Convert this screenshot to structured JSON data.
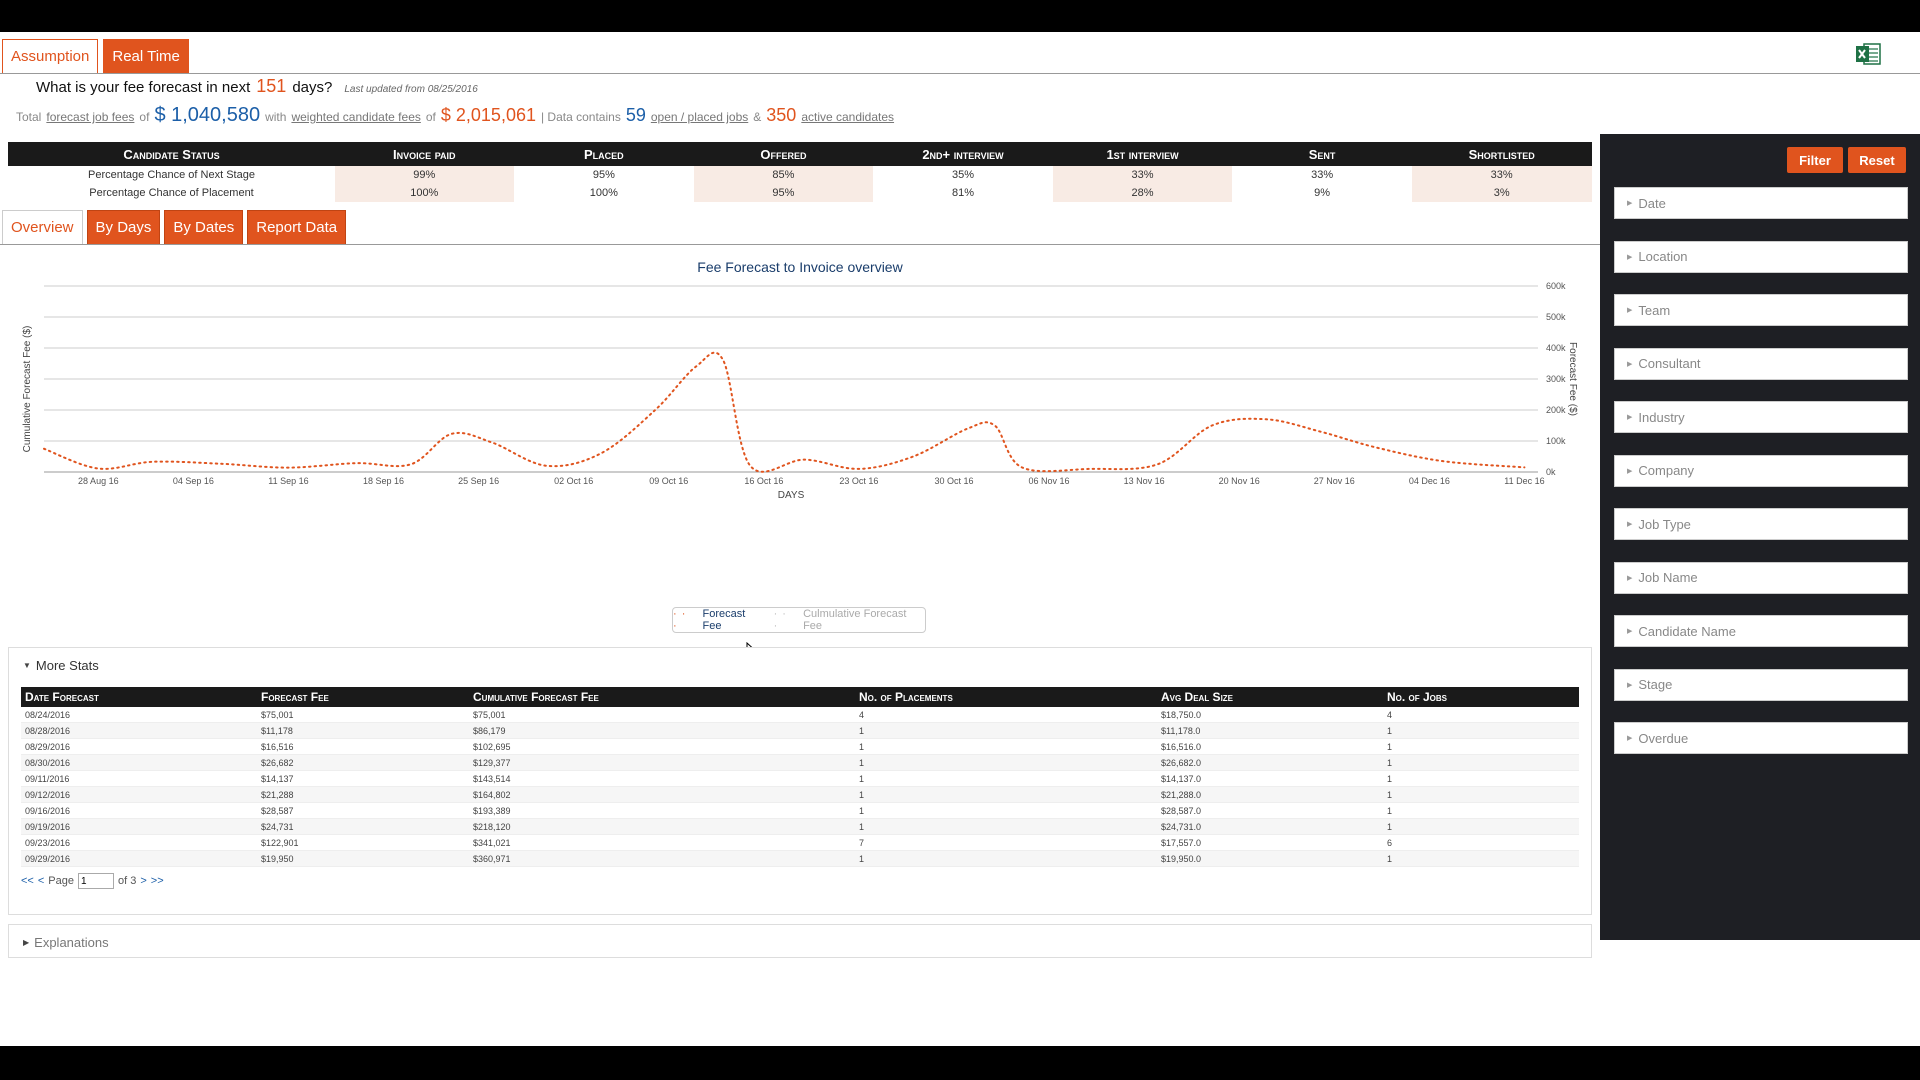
{
  "mode_tabs": [
    {
      "label": "Assumption",
      "active": true
    },
    {
      "label": "Real Time",
      "active": false
    }
  ],
  "question": {
    "prefix": "What is your fee forecast in next",
    "days": "151",
    "suffix": "days?",
    "updated": "Last updated from 08/25/2016"
  },
  "summary": {
    "total": "Total",
    "link1": "forecast job fees",
    "of1": "of",
    "value1": "$ 1,040,580",
    "with": "with",
    "link2": "weighted candidate fees",
    "of2": "of",
    "value2": "$ 2,015,061",
    "contains": "| Data contains",
    "jobs_count": "59",
    "link3": "open / placed jobs",
    "amp": "&",
    "cand_count": "350",
    "link4": "active candidates"
  },
  "status_table": {
    "headers": [
      "Candidate Status",
      "Invoice paid",
      "Placed",
      "Offered",
      "2nd+ interview",
      "1st interview",
      "Sent",
      "Shortlisted"
    ],
    "rows": [
      [
        "Percentage Chance of Next Stage",
        "99%",
        "95%",
        "85%",
        "35%",
        "33%",
        "33%",
        "33%"
      ],
      [
        "Percentage Chance of Placement",
        "100%",
        "100%",
        "95%",
        "81%",
        "28%",
        "9%",
        "3%"
      ]
    ]
  },
  "view_tabs": [
    {
      "label": "Overview",
      "active": true
    },
    {
      "label": "By Days",
      "active": false
    },
    {
      "label": "By Dates",
      "active": false
    },
    {
      "label": "Report Data",
      "active": false
    }
  ],
  "chart_data": {
    "type": "line",
    "title": "Fee Forecast to Invoice overview",
    "xlabel": "DAYS",
    "ylabel_left": "Cumulative Forecast Fee ($)",
    "ylabel_right": "Forecast Fee ($)",
    "x_ticks": [
      "28 Aug 16",
      "04 Sep 16",
      "11 Sep 16",
      "18 Sep 16",
      "25 Sep 16",
      "02 Oct 16",
      "09 Oct 16",
      "16 Oct 16",
      "23 Oct 16",
      "30 Oct 16",
      "06 Nov 16",
      "13 Nov 16",
      "20 Nov 16",
      "27 Nov 16",
      "04 Dec 16",
      "11 Dec 16"
    ],
    "y_ticks": [
      "600k",
      "500k",
      "400k",
      "300k",
      "200k",
      "100k",
      "0k"
    ],
    "ylim": [
      0,
      600000
    ],
    "xlim": [
      "2016-08-24",
      "2016-12-12"
    ],
    "grid": true,
    "legend_position": "bottom",
    "series": [
      {
        "name": "Forecast Fee",
        "color": "#e0541e",
        "visible": true,
        "x": [
          "2016-08-24",
          "2016-08-28",
          "2016-09-01",
          "2016-09-06",
          "2016-09-11",
          "2016-09-16",
          "2016-09-20",
          "2016-09-23",
          "2016-09-26",
          "2016-09-30",
          "2016-10-04",
          "2016-10-08",
          "2016-10-11",
          "2016-10-13",
          "2016-10-15",
          "2016-10-19",
          "2016-10-23",
          "2016-10-27",
          "2016-10-31",
          "2016-11-02",
          "2016-11-04",
          "2016-11-09",
          "2016-11-14",
          "2016-11-18",
          "2016-11-22",
          "2016-11-26",
          "2016-11-30",
          "2016-12-05",
          "2016-12-11"
        ],
        "y": [
          75000,
          11178,
          33000,
          26682,
          14137,
          28587,
          24731,
          122901,
          95000,
          20000,
          60000,
          200000,
          340000,
          360971,
          20000,
          40000,
          10000,
          50000,
          140000,
          150000,
          15000,
          10000,
          25000,
          150000,
          170000,
          130000,
          80000,
          35000,
          15000
        ]
      },
      {
        "name": "Culmulative Forecast Fee",
        "visible": false
      }
    ]
  },
  "more_stats": {
    "title": "More Stats",
    "headers": [
      "Date Forecast",
      "Forecast Fee",
      "Cumulative Forecast Fee",
      "No. of Placements",
      "Avg Deal Size",
      "No. of Jobs"
    ],
    "rows": [
      [
        "08/24/2016",
        "$75,001",
        "$75,001",
        "4",
        "$18,750.0",
        "4"
      ],
      [
        "08/28/2016",
        "$11,178",
        "$86,179",
        "1",
        "$11,178.0",
        "1"
      ],
      [
        "08/29/2016",
        "$16,516",
        "$102,695",
        "1",
        "$16,516.0",
        "1"
      ],
      [
        "08/30/2016",
        "$26,682",
        "$129,377",
        "1",
        "$26,682.0",
        "1"
      ],
      [
        "09/11/2016",
        "$14,137",
        "$143,514",
        "1",
        "$14,137.0",
        "1"
      ],
      [
        "09/12/2016",
        "$21,288",
        "$164,802",
        "1",
        "$21,288.0",
        "1"
      ],
      [
        "09/16/2016",
        "$28,587",
        "$193,389",
        "1",
        "$28,587.0",
        "1"
      ],
      [
        "09/19/2016",
        "$24,731",
        "$218,120",
        "1",
        "$24,731.0",
        "1"
      ],
      [
        "09/23/2016",
        "$122,901",
        "$341,021",
        "7",
        "$17,557.0",
        "6"
      ],
      [
        "09/29/2016",
        "$19,950",
        "$360,971",
        "1",
        "$19,950.0",
        "1"
      ]
    ],
    "pager": {
      "first": "<<",
      "prev": "<",
      "page_label": "Page",
      "page_value": "1",
      "of_label": "of 3",
      "next": ">",
      "last": ">>"
    }
  },
  "explanations": {
    "title": "Explanations"
  },
  "sidebar": {
    "filter_label": "Filter",
    "reset_label": "Reset",
    "filters": [
      "Date",
      "Location",
      "Team",
      "Consultant",
      "Industry",
      "Company",
      "Job Type",
      "Job Name",
      "Candidate Name",
      "Stage",
      "Overdue"
    ]
  },
  "colors": {
    "accent": "#e0541e",
    "blue": "#1c5fa8",
    "dark": "#1a1a1a",
    "sidebar": "#1e1f24"
  }
}
